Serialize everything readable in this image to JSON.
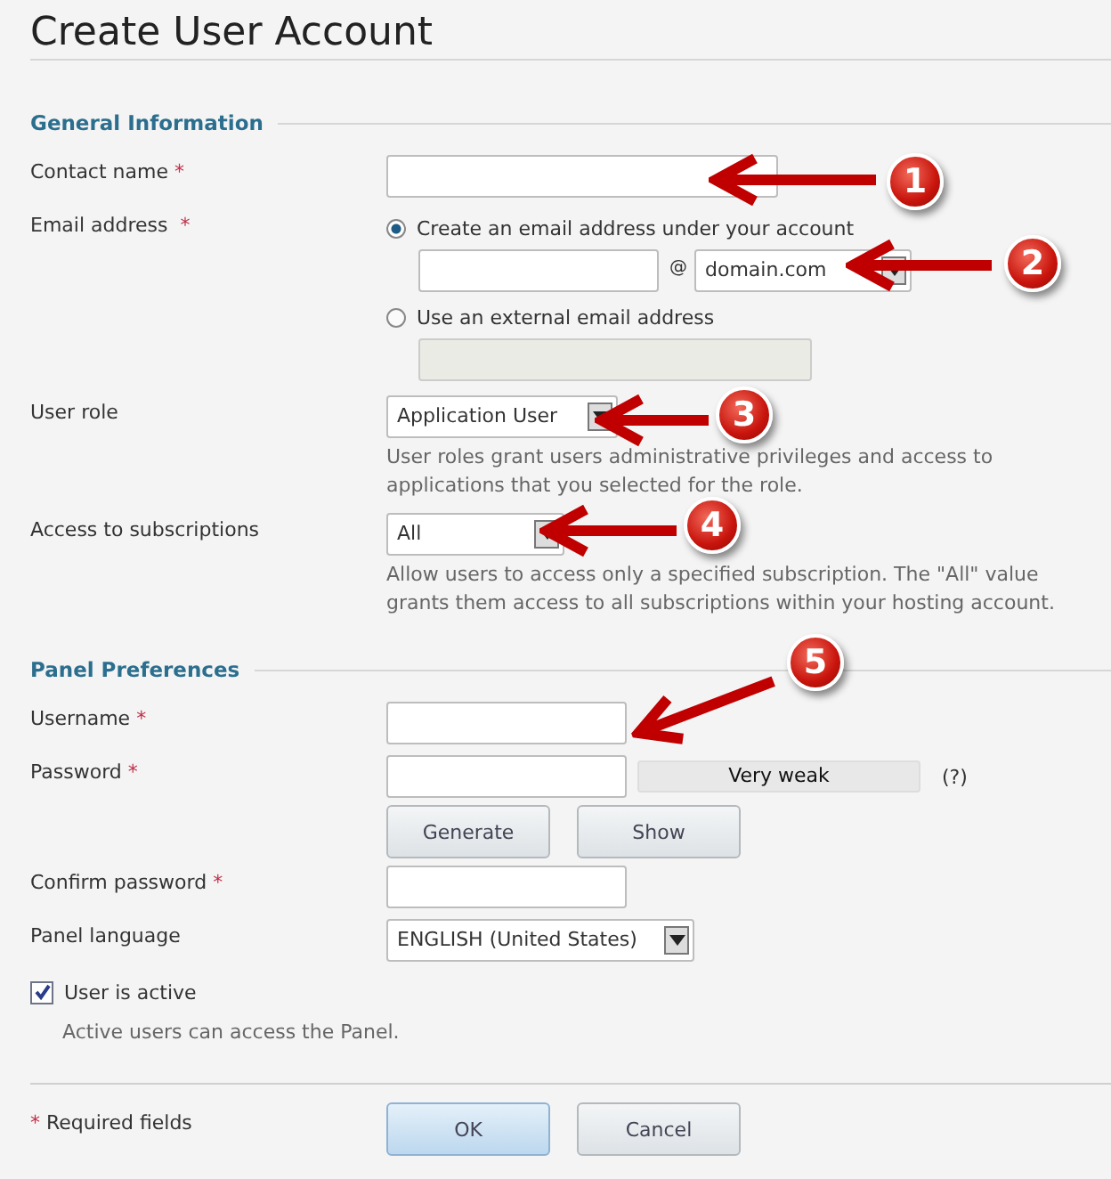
{
  "title": "Create User Account",
  "general": {
    "heading": "General Information",
    "contact_name": {
      "label": "Contact name",
      "required_mark": "*"
    },
    "email": {
      "label": "Email address",
      "required_mark": "*",
      "options": [
        {
          "kind": "own_domain",
          "label": "Create an email address under your account",
          "selected": true,
          "at_sign": "@",
          "domain": "domain.com"
        },
        {
          "kind": "external",
          "label": "Use an external email address",
          "selected": false
        }
      ]
    },
    "user_role": {
      "label": "User role",
      "value": "Application User",
      "hint": "User roles grant users administrative privileges and access to applications that you selected for the role."
    },
    "subscriptions": {
      "label": "Access to subscriptions",
      "value": "All",
      "hint": "Allow users to access only a specified subscription. The \"All\" value grants them access to all subscriptions within your hosting account."
    }
  },
  "panel": {
    "heading": "Panel Preferences",
    "username": {
      "label": "Username",
      "required_mark": "*"
    },
    "password": {
      "label": "Password",
      "required_mark": "*",
      "strength": "Very weak",
      "help": "(?)"
    },
    "buttons": [
      "Generate",
      "Show"
    ],
    "confirm": {
      "label": "Confirm password",
      "required_mark": "*"
    },
    "language": {
      "label": "Panel language",
      "value": "ENGLISH (United States)"
    },
    "active": {
      "label": "User is active",
      "checked": true,
      "hint": "Active users can access the Panel."
    }
  },
  "footer": {
    "required_mark": "*",
    "note": "Required fields",
    "buttons": [
      {
        "label": "OK",
        "primary": true
      },
      {
        "label": "Cancel",
        "primary": false
      }
    ]
  },
  "annotations": [
    {
      "number": "1"
    },
    {
      "number": "2"
    },
    {
      "number": "3"
    },
    {
      "number": "4"
    },
    {
      "number": "5"
    }
  ]
}
